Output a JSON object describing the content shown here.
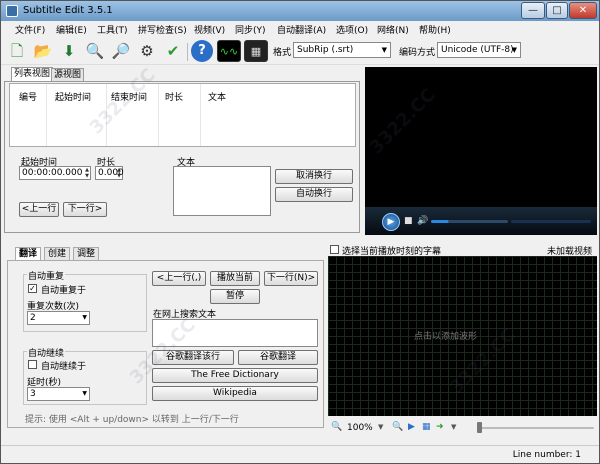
{
  "window": {
    "title": "Subtitle Edit 3.5.1",
    "min": "—",
    "max": "□",
    "close": "✕"
  },
  "menu": [
    {
      "label": "文件(F)"
    },
    {
      "label": "编辑(E)"
    },
    {
      "label": "工具(T)"
    },
    {
      "label": "拼写检查(S)"
    },
    {
      "label": "视频(V)"
    },
    {
      "label": "同步(Y)"
    },
    {
      "label": "自动翻译(A)"
    },
    {
      "label": "选项(O)"
    },
    {
      "label": "网络(N)"
    },
    {
      "label": "帮助(H)"
    }
  ],
  "toolbar": {
    "icons": [
      "new-file-icon",
      "open-folder-icon",
      "save-icon",
      "find-icon",
      "replace-icon",
      "fix-icon",
      "spell-check-icon",
      "help-icon",
      "waveform-toggle-icon",
      "video-toggle-icon"
    ],
    "format_label": "格式",
    "format_value": "SubRip (.srt)",
    "encoding_label": "编码方式",
    "encoding_value": "Unicode (UTF-8)"
  },
  "tabs_top": [
    {
      "label": "列表视图"
    },
    {
      "label": "源视图"
    }
  ],
  "grid_headers": [
    "编号",
    "起始时间",
    "结束时间",
    "时长",
    "文本"
  ],
  "editor": {
    "start_label": "起始时间",
    "start_value": "00:00:00.000",
    "duration_label": "时长",
    "duration_value": "0.000",
    "text_label": "文本",
    "unbreak_button": "取消换行",
    "autobreak_button": "自动换行",
    "prev_button": "<上一行",
    "next_button": "下一行>"
  },
  "bottom_tabs": [
    {
      "label": "翻译"
    },
    {
      "label": "创建"
    },
    {
      "label": "调整"
    }
  ],
  "translate": {
    "auto_repeat_group": "自动重复",
    "auto_repeat_check": "自动重复于",
    "repeat_count_label": "重复次数(次)",
    "repeat_count_value": "2",
    "auto_continue_group": "自动继续",
    "auto_continue_check": "自动继续于",
    "delay_label": "延时(秒)",
    "delay_value": "3",
    "prev_button": "<上一行(,)",
    "play_current_button": "播放当前",
    "next_button": "下一行(N)>",
    "pause_button": "暂停",
    "search_label": "在网上搜索文本",
    "google_it_button": "谷歌翻译该行",
    "google_translate_button": "谷歌翻译",
    "free_dictionary_button": "The Free Dictionary",
    "wikipedia_button": "Wikipedia",
    "hint": "提示: 使用 <Alt + up/down> 以转到 上一行/下一行"
  },
  "waveform": {
    "select_current_label": "选择当前播放时刻的字幕",
    "no_video_label": "未加载视频",
    "placeholder": "点击以添加波形",
    "zoom_value": "100%"
  },
  "status": {
    "line_number": "Line number: 1"
  },
  "watermark": "3322.CC"
}
